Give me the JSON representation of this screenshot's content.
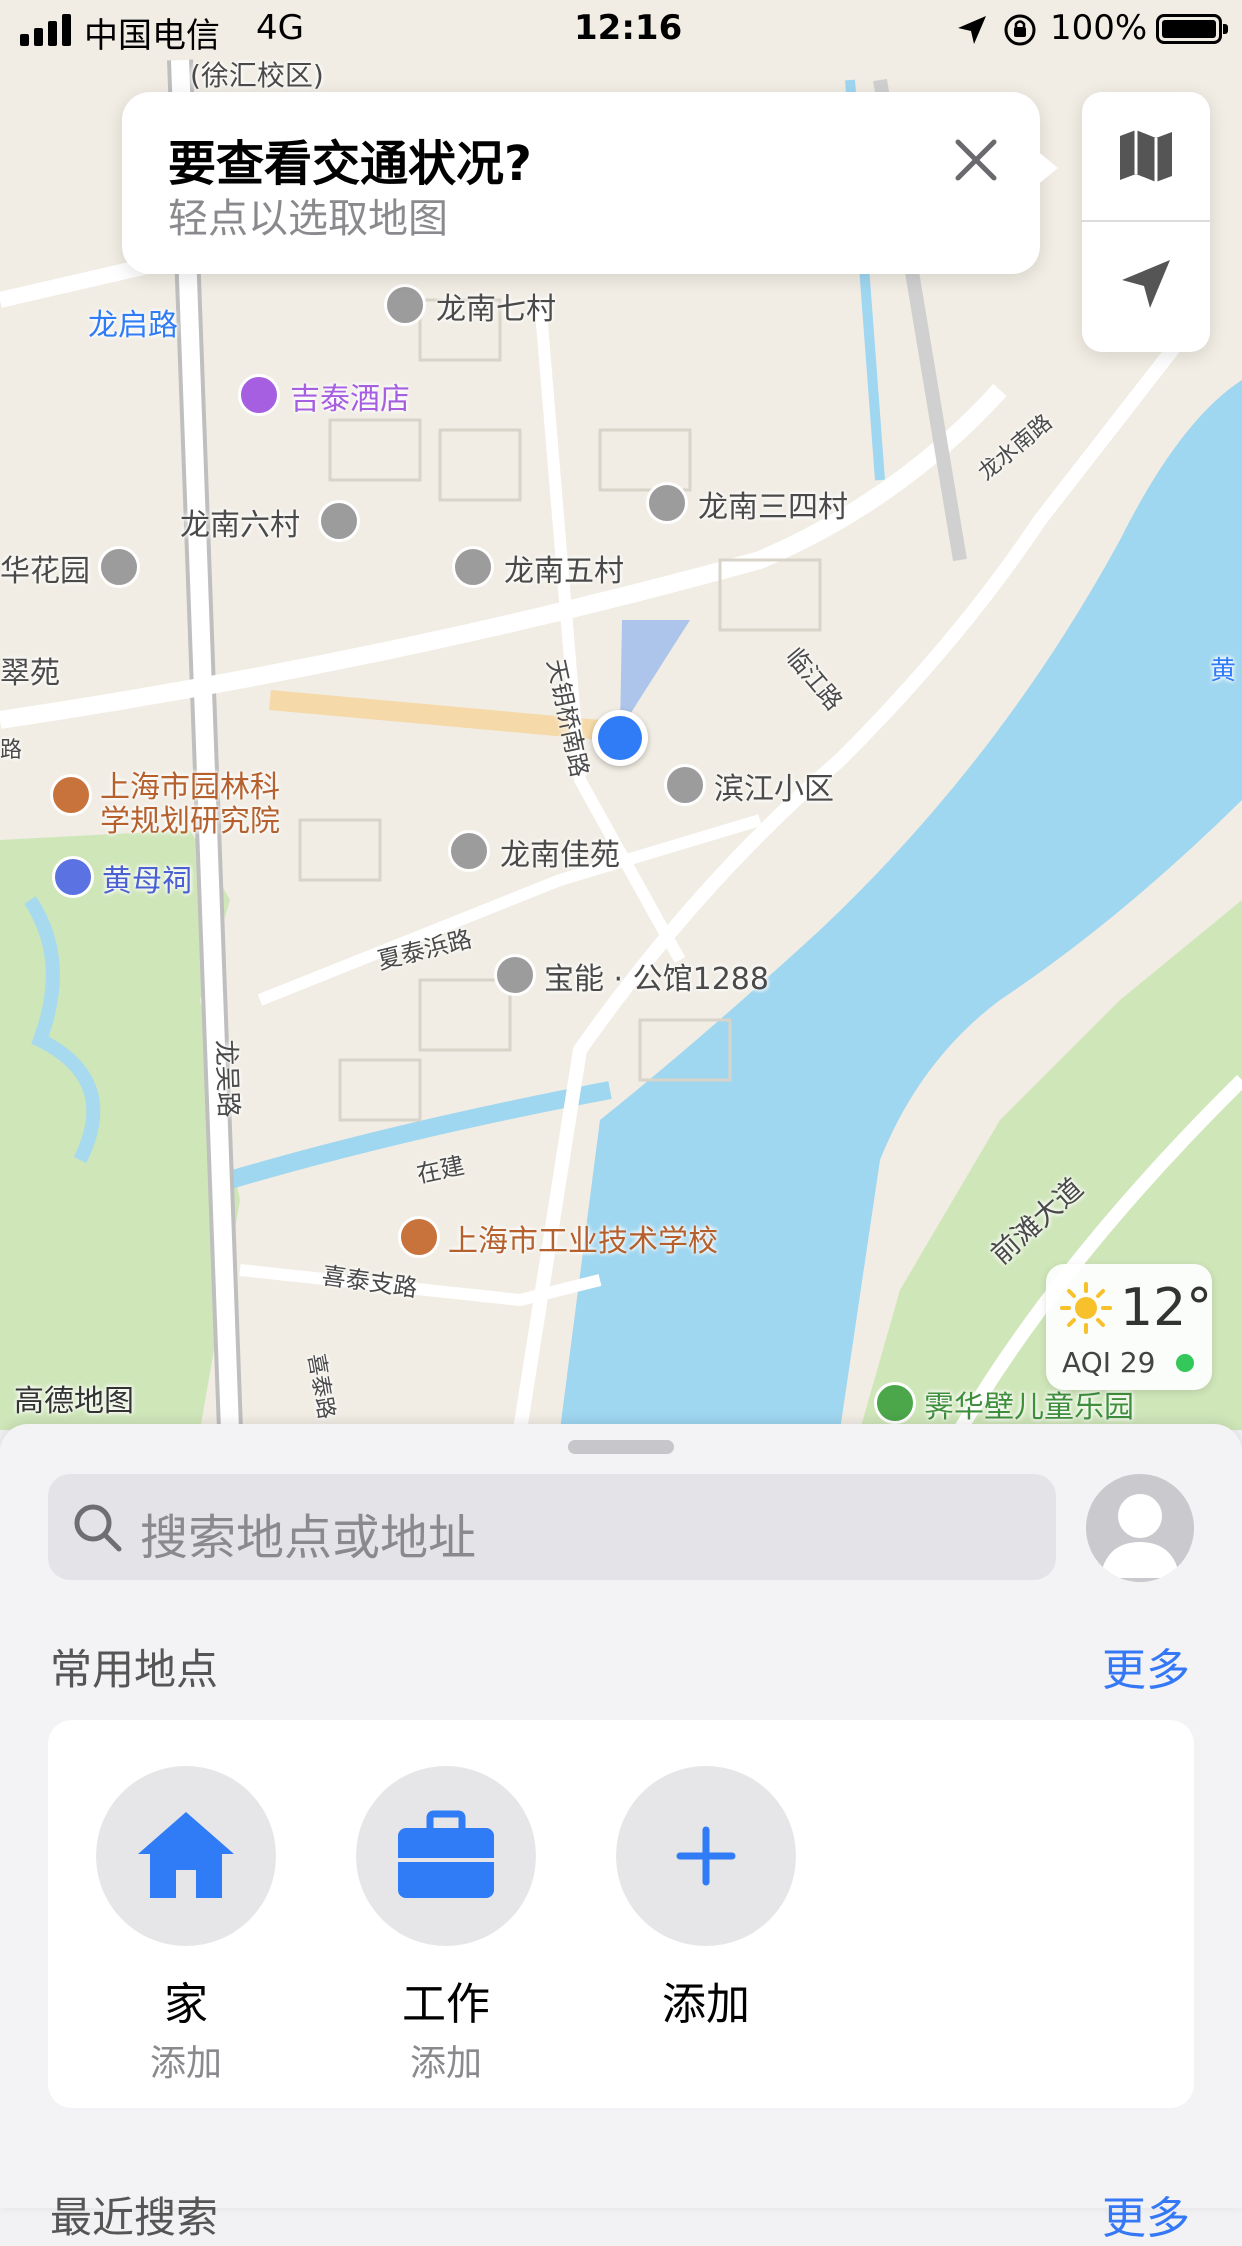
{
  "status_bar": {
    "carrier": "中国电信",
    "network": "4G",
    "time": "12:16",
    "battery": "100%"
  },
  "map": {
    "watermark": "高德地图",
    "labels": {
      "xuhui": "(徐汇校区)",
      "longqi_road": "龙启路",
      "longnan7": "龙南七村",
      "jitai_hotel": "吉泰酒店",
      "longnan6": "龙南六村",
      "longnan34": "龙南三四村",
      "huahuayuan": "华花园",
      "longnan5": "龙南五村",
      "cuiyuan": "翠苑",
      "linjiang_road": "临江路",
      "tianyaoqiao_south": "天钥桥南路",
      "binjiang": "滨江小区",
      "garden_institute_1": "上海市园林科",
      "garden_institute_2": "学规划研究院",
      "huangmu_temple": "黄母祠",
      "longnanjiayuan": "龙南佳苑",
      "xiataibang_road": "夏泰浜路",
      "baoneng": "宝能 · 公馆1288",
      "longwu_road": "龙吴路",
      "zaijian": "在建",
      "industrial_school": "上海市工业技术学校",
      "xitai_branch_road": "喜泰支路",
      "longshui_south": "龙水南路",
      "qiantan_avenue": "前滩大道",
      "jihua_park": "霁华壁儿童乐园",
      "xitai_road": "喜泰路",
      "bian_road": "路",
      "huang": "黄"
    },
    "traffic_callout": {
      "title": "要查看交通状况?",
      "subtitle": "轻点以选取地图"
    },
    "weather": {
      "temperature": "12°",
      "aqi": "AQI 29",
      "aqi_color": "#34c759"
    },
    "accent_location": "#2f7cf6"
  },
  "sheet": {
    "search_placeholder": "搜索地点或地址",
    "favorites_title": "常用地点",
    "favorites_more": "更多",
    "favorites": [
      {
        "name": "家",
        "sub": "添加",
        "icon": "house-icon"
      },
      {
        "name": "工作",
        "sub": "添加",
        "icon": "briefcase-icon"
      },
      {
        "name": "添加",
        "sub": "",
        "icon": "plus-icon"
      }
    ],
    "recent_title": "最近搜索",
    "recent_more": "更多"
  }
}
